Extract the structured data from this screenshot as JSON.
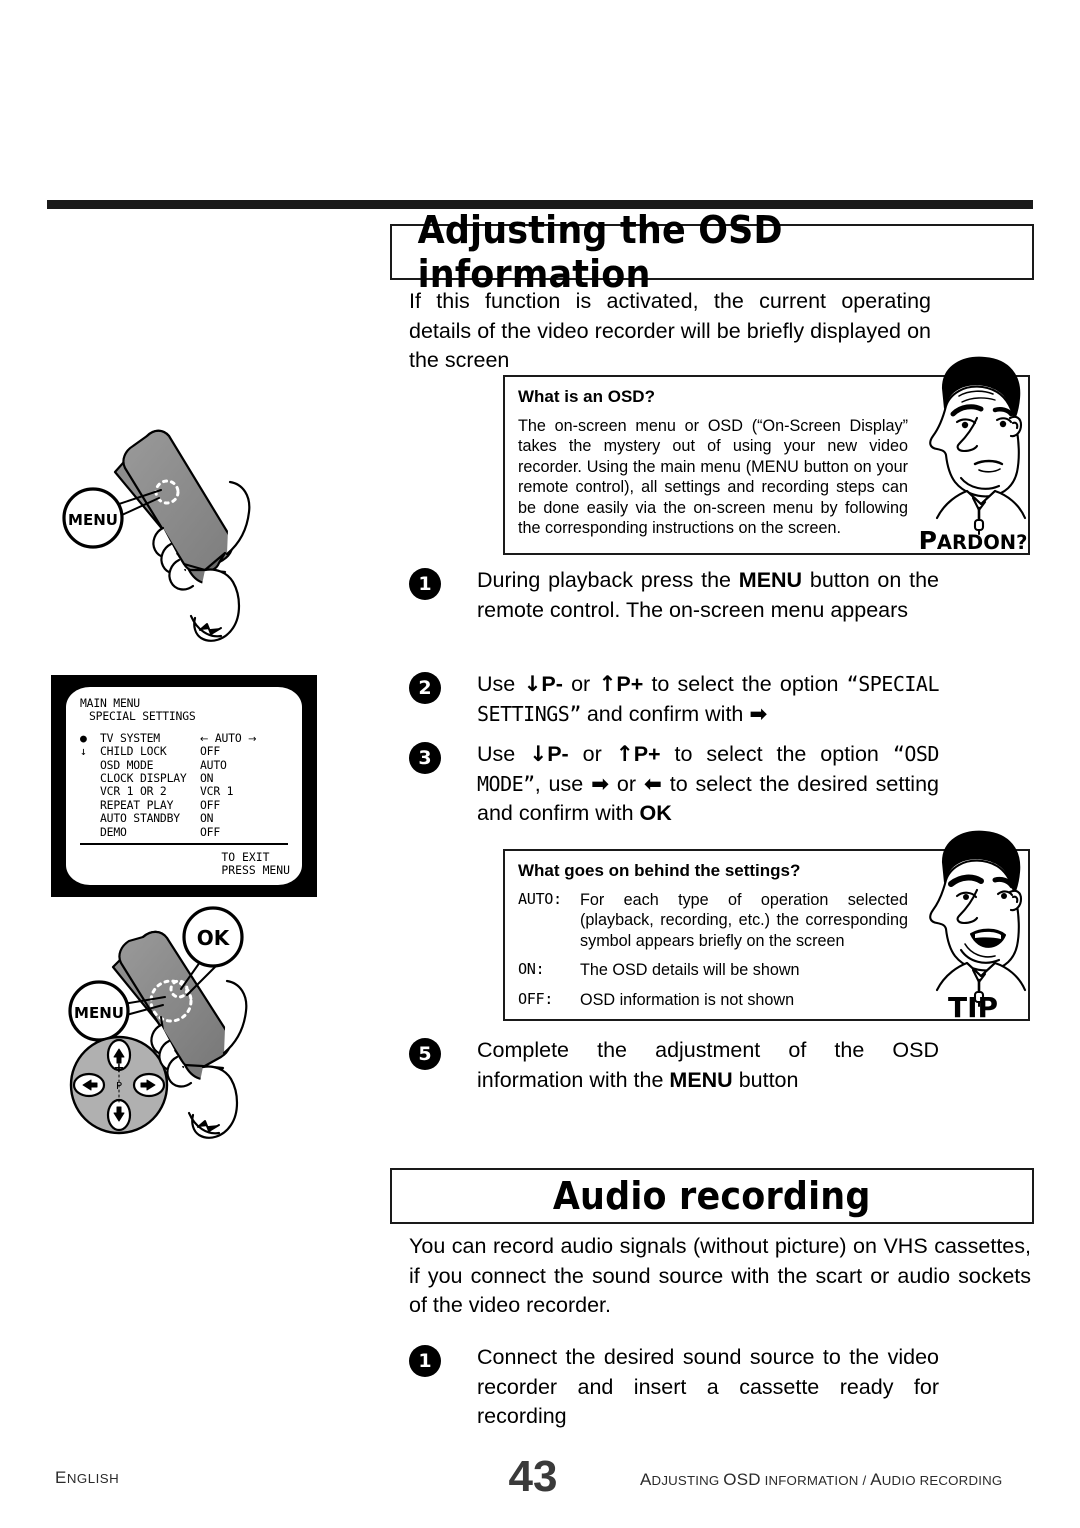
{
  "sections": {
    "osd": {
      "heading": "Adjusting the OSD information",
      "intro": "If this function is activated, the current operating details of the video recorder will be briefly displayed on the screen"
    },
    "audio": {
      "heading": "Audio recording",
      "intro": "You can record audio signals (without picture) on VHS cassettes, if you connect the sound source with the scart or audio sockets of the video recorder."
    }
  },
  "pardon_box": {
    "title": "What is an OSD?",
    "body": "The on-screen menu or OSD (“On-Screen Display” takes the mystery out of using your new video recorder. Using the main menu (MENU button on your remote control), all settings and recording steps can be done easily via the on-screen menu by following the corresponding instructions on the screen.",
    "caption": "Pardon?",
    "caption_first": "P",
    "caption_rest": "ARDON?"
  },
  "tip_box": {
    "title": "What goes on behind the settings?",
    "rows": [
      {
        "key": "AUTO:",
        "value": "For each type of operation selected (playback, recording, etc.) the corresponding symbol appears briefly on the screen"
      },
      {
        "key": "ON:",
        "value": "The OSD details will be shown"
      },
      {
        "key": "OFF:",
        "value": "OSD information is not shown"
      }
    ],
    "caption": "TIP"
  },
  "steps": {
    "s1": {
      "num": "1",
      "p1": "During playback press the ",
      "menu": "MENU",
      "p2": " button on the remote control. The on-screen menu appears"
    },
    "s2": {
      "num": "2",
      "p1": "Use ",
      "down": "↓",
      "pminus": "P-",
      "p2": " or ",
      "up": "↑",
      "pplus": "P+",
      "p3": " to select the option ",
      "option": "“SPECIAL SETTINGS”",
      "p4": " and confirm with ",
      "right": "➡"
    },
    "s3": {
      "num": "3",
      "p1": "Use ",
      "down": "↓",
      "pminus": "P-",
      "p2": " or ",
      "up": "↑",
      "pplus": "P+",
      "p3": " to select the option ",
      "option": "“OSD MODE”",
      "p4": ", use ",
      "right": "➡",
      "p5": " or ",
      "left": "⬅",
      "p6": " to select the desired setting and confirm with ",
      "ok": "OK"
    },
    "s5": {
      "num": "5",
      "p1": "Complete the adjustment of the OSD information with the ",
      "menu": "MENU",
      "p2": " button"
    },
    "a1": {
      "num": "1",
      "p1": "Connect the desired sound source to the video recorder and insert a cassette ready for recording"
    }
  },
  "tv_screen": {
    "header_line1": "MAIN MENU",
    "header_line2": "SPECIAL SETTINGS",
    "rows": [
      {
        "mark": "●",
        "name": "TV SYSTEM",
        "value": "AUTO",
        "arrows": true
      },
      {
        "mark": "↓",
        "name": "CHILD LOCK",
        "value": "OFF",
        "arrows": false
      },
      {
        "mark": "",
        "name": "OSD MODE",
        "value": "AUTO",
        "arrows": false
      },
      {
        "mark": "",
        "name": "CLOCK DISPLAY",
        "value": "ON",
        "arrows": false
      },
      {
        "mark": "",
        "name": "VCR 1 OR 2",
        "value": "VCR 1",
        "arrows": false
      },
      {
        "mark": "",
        "name": "REPEAT PLAY",
        "value": "OFF",
        "arrows": false
      },
      {
        "mark": "",
        "name": "AUTO STANDBY",
        "value": "ON",
        "arrows": false
      },
      {
        "mark": "",
        "name": "DEMO",
        "value": "OFF",
        "arrows": false
      }
    ],
    "exit_line1": "TO EXIT",
    "exit_line2": "PRESS MENU",
    "arrow_left": "←",
    "arrow_right": "→"
  },
  "remote_top": {
    "callout_menu": "MENU"
  },
  "remote_bottom": {
    "callout_menu": "MENU",
    "callout_ok": "OK",
    "pad_center": "P",
    "pad_up": "+",
    "pad_down": "–"
  },
  "footer": {
    "language": "English",
    "language_first": "E",
    "language_rest": "NGLISH",
    "page": "43",
    "caption_parts": [
      "A",
      "DJUSTING ",
      "OSD",
      " INFORMATION / ",
      "A",
      "UDIO RECORDING"
    ]
  },
  "colors": {
    "ink": "#000000",
    "rule": "#1a1a1a",
    "footer_gray": "#2b2b2b"
  }
}
